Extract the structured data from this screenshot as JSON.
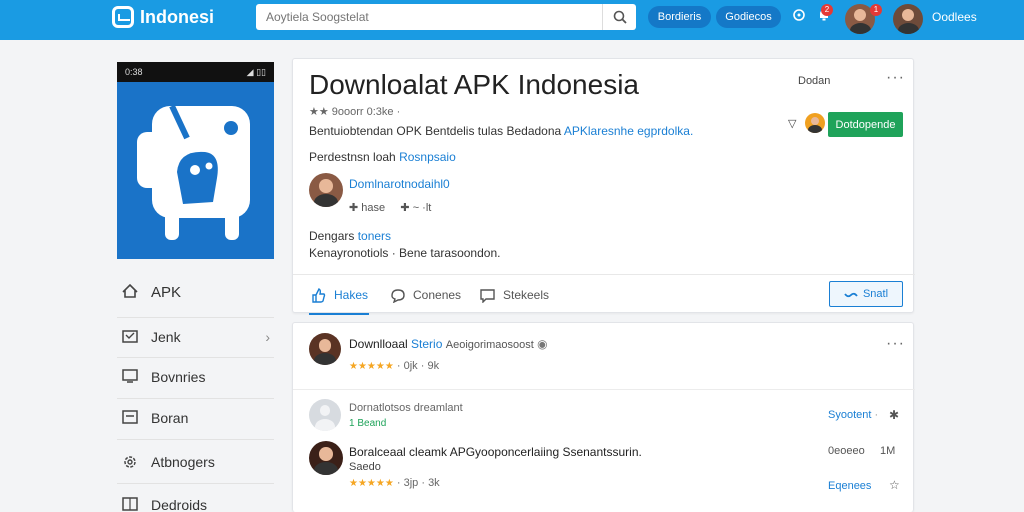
{
  "header": {
    "logo_text": "Indonesi",
    "search_placeholder": "Aoytiela Soogstelat",
    "pill_1": "Bordieris",
    "pill_2": "Godiecos",
    "notif_count": "2",
    "msg_count": "1",
    "user_name": "Oodlees"
  },
  "sidebar": {
    "status_left": "0:38",
    "status_right": "◢ ▯▯",
    "apk_label": "APK",
    "items": [
      {
        "label": "Jenk"
      },
      {
        "label": "Bovnries"
      },
      {
        "label": "Boran"
      },
      {
        "label": "Atbnogers"
      },
      {
        "label": "Dedroids"
      }
    ]
  },
  "main": {
    "title": "Downloalat APK Indonesia",
    "meta_line": "★★ 9ooorr 0:3ke ·",
    "desc_prefix": "Bentuiobtendan OPK Bentdelis tulas Bedadona ",
    "desc_link": "APKlaresnhe egprdolka.",
    "posted_prefix": "Perdestnsn loah ",
    "posted_link": "Rosnpsaio",
    "author_name": "Domlnarotnodaihl0",
    "author_stat_1": "hase",
    "author_stat_2": "~ ·lt",
    "section_label": "Dengars ",
    "section_link": "toners",
    "section_line": "Kenayronotiols  ·  Bene tarasoondon.",
    "top_right_label": "Dodan",
    "install_btn": "Dotdopende",
    "tabs": [
      {
        "label": "Hakes"
      },
      {
        "label": "Conenes"
      },
      {
        "label": "Stekeels"
      }
    ],
    "share_btn": "Snatl"
  },
  "reviews": [
    {
      "name": "Downlloaal",
      "name_link": "Sterio",
      "name_rest": "Aeoigorimaosoost",
      "stars": "★★★★★",
      "meta": "· 0jk · 9k"
    },
    {
      "name": "Dornatlotsos dreamlant",
      "sub": "1 Beand",
      "action_link": "Syootent",
      "action_extra": "·"
    },
    {
      "name": "Boralceaal cleamk APGyooponcerlaiing  Ssenantssurin.",
      "sub": "Saedo",
      "stars": "★★★★★",
      "meta": "· 3jp · 3k",
      "right_meta": "0eoeeo",
      "right_count": "1M",
      "action_link": "Eqenees"
    }
  ],
  "colors": {
    "topbar": "#1a9be3",
    "accent": "#1a7fd4",
    "install": "#1fa35a",
    "app_tile": "#1a73c8"
  }
}
